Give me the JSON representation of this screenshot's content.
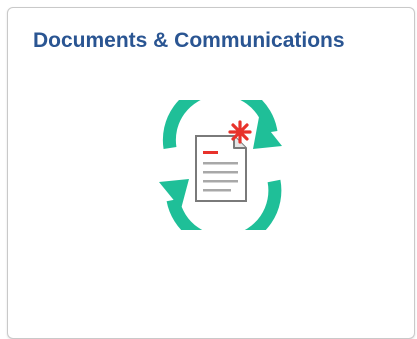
{
  "tile": {
    "title": "Documents & Communications",
    "icon": "document-sync-icon"
  },
  "colors": {
    "title": "#2a5592",
    "arrows": "#1fbf98",
    "document_border": "#7a7a7a",
    "document_fold": "#e6e6e6",
    "accent_red": "#e8322b",
    "text_lines": "#a8a8a8"
  }
}
